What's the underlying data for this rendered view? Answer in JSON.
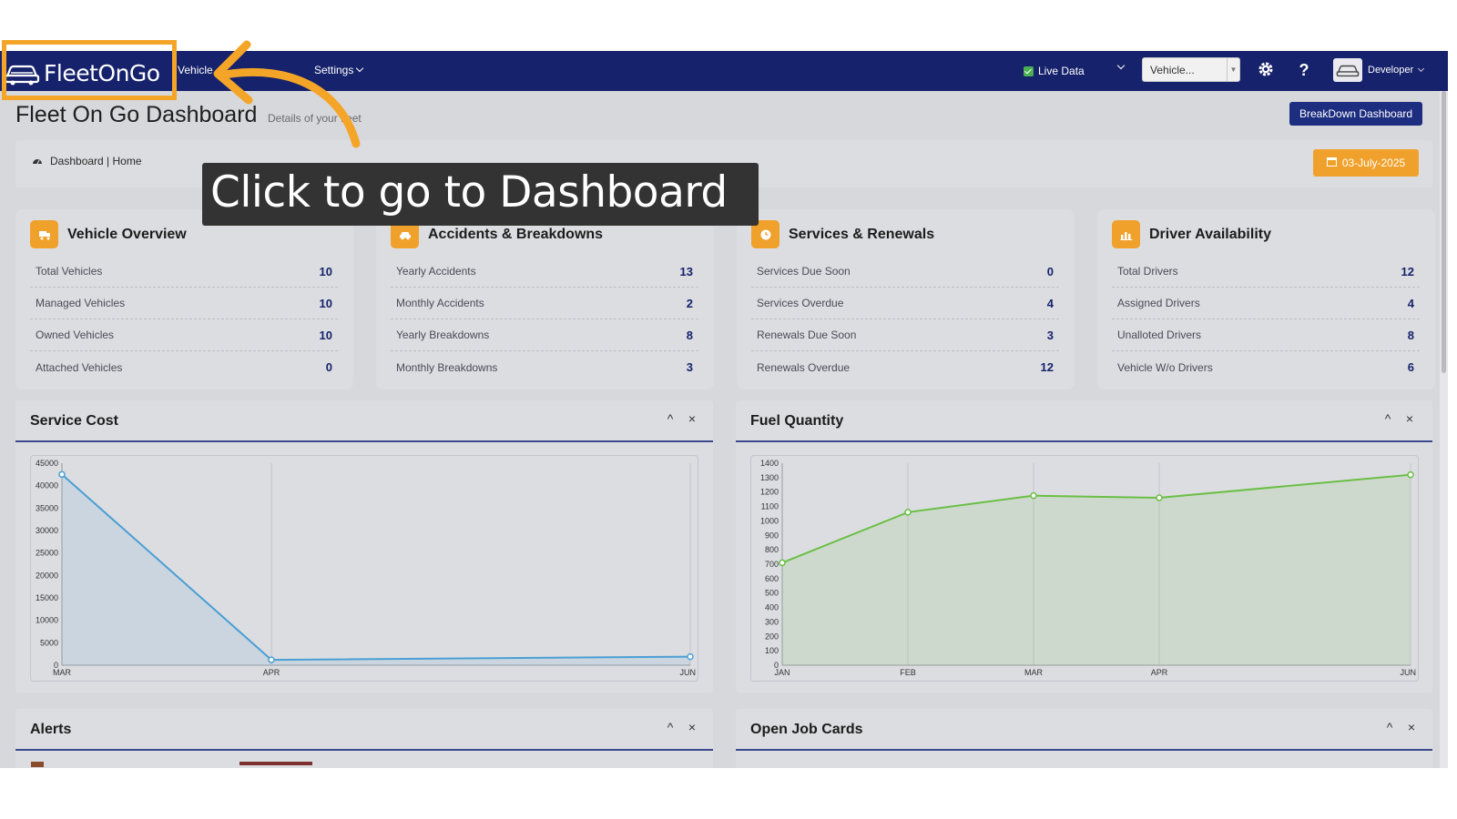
{
  "navbar": {
    "logo_text": "FleetOnGo",
    "items": [
      {
        "label": "Vehicle"
      },
      {
        "label": "Settings"
      }
    ],
    "live_data_label": "Live Data",
    "vehicle_select_value": "Vehicle...",
    "user_name": "Developer"
  },
  "page": {
    "title": "Fleet On Go Dashboard",
    "subtitle": "Details of your fleet",
    "breakdown_button": "BreakDown Dashboard"
  },
  "breadcrumb": {
    "text": "Dashboard | Home",
    "date": "03-July-2025"
  },
  "cards": [
    {
      "title": "Vehicle Overview",
      "icon": "truck-icon",
      "rows": [
        {
          "label": "Total Vehicles",
          "value": "10"
        },
        {
          "label": "Managed Vehicles",
          "value": "10"
        },
        {
          "label": "Owned Vehicles",
          "value": "10"
        },
        {
          "label": "Attached Vehicles",
          "value": "0"
        }
      ]
    },
    {
      "title": "Accidents & Breakdowns",
      "icon": "car-icon",
      "rows": [
        {
          "label": "Yearly Accidents",
          "value": "13"
        },
        {
          "label": "Monthly Accidents",
          "value": "2"
        },
        {
          "label": "Yearly Breakdowns",
          "value": "8"
        },
        {
          "label": "Monthly Breakdowns",
          "value": "3"
        }
      ]
    },
    {
      "title": "Services & Renewals",
      "icon": "clock-icon",
      "rows": [
        {
          "label": "Services Due Soon",
          "value": "0"
        },
        {
          "label": "Services Overdue",
          "value": "4"
        },
        {
          "label": "Renewals Due Soon",
          "value": "3"
        },
        {
          "label": "Renewals Overdue",
          "value": "12"
        }
      ]
    },
    {
      "title": "Driver Availability",
      "icon": "bar-chart-icon",
      "rows": [
        {
          "label": "Total Drivers",
          "value": "12"
        },
        {
          "label": "Assigned Drivers",
          "value": "4"
        },
        {
          "label": "Unalloted Drivers",
          "value": "8"
        },
        {
          "label": "Vehicle W/o Drivers",
          "value": "6"
        }
      ]
    }
  ],
  "panels": {
    "service_cost": {
      "title": "Service Cost",
      "collapse": "^",
      "close": "×"
    },
    "fuel_quantity": {
      "title": "Fuel Quantity",
      "collapse": "^",
      "close": "×"
    },
    "alerts": {
      "title": "Alerts",
      "collapse": "^",
      "close": "×"
    },
    "open_job_cards": {
      "title": "Open Job Cards",
      "collapse": "^",
      "close": "×"
    }
  },
  "chart_data": [
    {
      "type": "area",
      "title": "",
      "xlabel": "",
      "ylabel": "",
      "categories": [
        "MAR",
        "APR",
        "JUN"
      ],
      "values": [
        42500,
        1200,
        1900
      ],
      "ylim": [
        0,
        45000
      ],
      "yticks": [
        0,
        5000,
        10000,
        15000,
        20000,
        25000,
        30000,
        35000,
        40000,
        45000
      ],
      "color": "#4a9fd4",
      "grid": true
    },
    {
      "type": "area",
      "title": "",
      "xlabel": "",
      "ylabel": "",
      "categories": [
        "JAN",
        "FEB",
        "MAR",
        "APR",
        "JUN"
      ],
      "values": [
        710,
        1060,
        1175,
        1160,
        1320
      ],
      "ylim": [
        0,
        1400
      ],
      "yticks": [
        0,
        100,
        200,
        300,
        400,
        500,
        600,
        700,
        800,
        900,
        1000,
        1100,
        1200,
        1300,
        1400
      ],
      "color": "#6abf45",
      "grid": true
    }
  ],
  "overlay": {
    "tooltip_text": "Click to go to Dashboard",
    "highlight_color": "#f4a527"
  }
}
